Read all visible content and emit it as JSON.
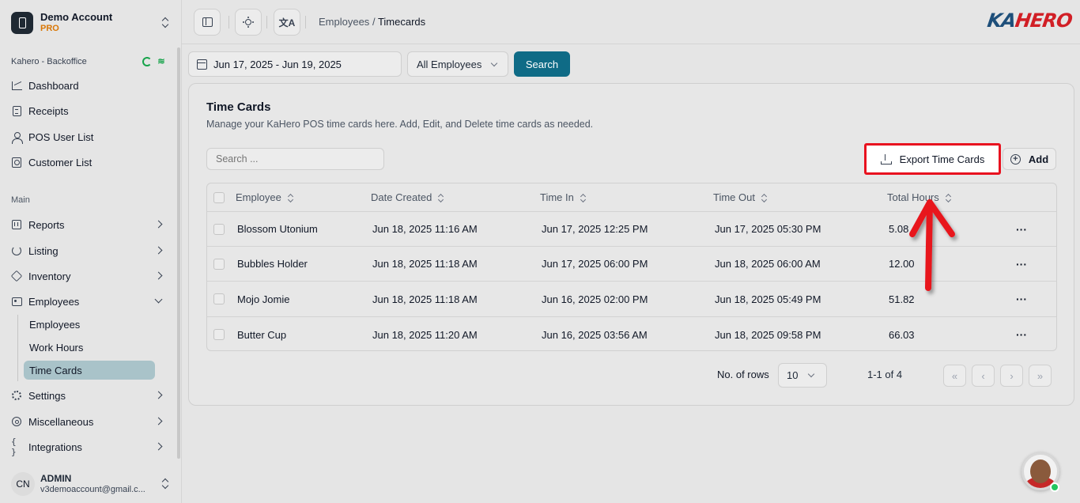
{
  "account": {
    "name": "Demo Account",
    "tier": "PRO"
  },
  "sidebar": {
    "branch": "Kahero - Backoffice",
    "top_items": [
      {
        "label": "Dashboard",
        "icon": "chart-icon"
      },
      {
        "label": "Receipts",
        "icon": "receipt-icon"
      },
      {
        "label": "POS User List",
        "icon": "user-icon"
      },
      {
        "label": "Customer List",
        "icon": "contact-card-icon"
      }
    ],
    "section_label": "Main",
    "main_items": [
      {
        "label": "Reports",
        "icon": "report-icon"
      },
      {
        "label": "Listing",
        "icon": "listing-icon"
      },
      {
        "label": "Inventory",
        "icon": "box-icon"
      },
      {
        "label": "Employees",
        "icon": "employee-icon",
        "expanded": true
      }
    ],
    "sub_items": [
      {
        "label": "Employees"
      },
      {
        "label": "Work Hours"
      },
      {
        "label": "Time Cards",
        "active": true
      }
    ],
    "bottom_items": [
      {
        "label": "Settings",
        "icon": "gear-icon"
      },
      {
        "label": "Miscellaneous",
        "icon": "misc-icon"
      },
      {
        "label": "Integrations",
        "icon": "braces-icon",
        "glyph": "{ }"
      }
    ],
    "user": {
      "initials": "CN",
      "name": "ADMIN",
      "email": "v3demoaccount@gmail.c..."
    }
  },
  "topbar": {
    "lang_glyph": "文A",
    "breadcrumb": {
      "parent": "Employees",
      "separator": "/",
      "current": "Timecards"
    },
    "logo": {
      "part1": "KA",
      "part2": "HERO"
    }
  },
  "filters": {
    "date_range": "Jun 17, 2025 - Jun 19, 2025",
    "employee_select": "All Employees",
    "search_button": "Search"
  },
  "card": {
    "title": "Time Cards",
    "description": "Manage your KaHero POS time cards here. Add, Edit, and Delete time cards as needed.",
    "search_placeholder": "Search ...",
    "export_button": "Export Time Cards",
    "add_button": "Add",
    "columns": [
      "Employee",
      "Date Created",
      "Time In",
      "Time Out",
      "Total Hours"
    ],
    "rows": [
      {
        "employee": "Blossom Utonium",
        "date_created": "Jun 18, 2025 11:16 AM",
        "time_in": "Jun 17, 2025 12:25 PM",
        "time_out": "Jun 17, 2025 05:30 PM",
        "total_hours": "5.08"
      },
      {
        "employee": "Bubbles Holder",
        "date_created": "Jun 18, 2025 11:18 AM",
        "time_in": "Jun 17, 2025 06:00 PM",
        "time_out": "Jun 18, 2025 06:00 AM",
        "total_hours": "12.00"
      },
      {
        "employee": "Mojo Jomie",
        "date_created": "Jun 18, 2025 11:18 AM",
        "time_in": "Jun 16, 2025 02:00 PM",
        "time_out": "Jun 18, 2025 05:49 PM",
        "total_hours": "51.82"
      },
      {
        "employee": "Butter Cup",
        "date_created": "Jun 18, 2025 11:20 AM",
        "time_in": "Jun 16, 2025 03:56 AM",
        "time_out": "Jun 18, 2025 09:58 PM",
        "total_hours": "66.03"
      }
    ],
    "row_actions_glyph": "···",
    "pagination": {
      "rows_label": "No. of rows",
      "rows_value": "10",
      "page_info": "1-1 of 4",
      "first": "«",
      "prev": "‹",
      "next": "›",
      "last": "»"
    }
  },
  "colors": {
    "primary": "#0f6b86",
    "active_nav": "#a9c3c9",
    "highlight_red": "#e8121f",
    "pro_badge": "#d97706",
    "logo_blue": "#1e4f7a",
    "logo_red": "#d11f26"
  }
}
